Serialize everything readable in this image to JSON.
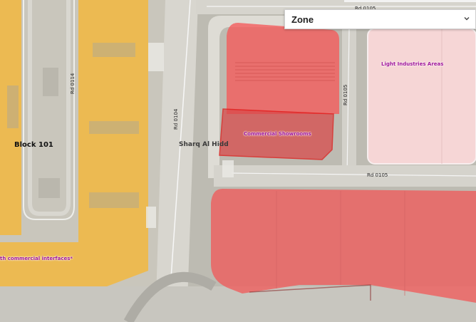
{
  "zone_selector": {
    "label": "Zone",
    "icon": "chevron-down-icon"
  },
  "roads": {
    "rd_0105_top": "Rd 0105",
    "rd_0105_mid": "Rd 0105",
    "rd_0105_vertical": "Rd 0105",
    "rd_0104": "Rd 0104",
    "rd_0114": "Rd 0114"
  },
  "places": {
    "block": "Block 101",
    "area": "Sharq Al Hidd"
  },
  "zones": {
    "light_industries": "Light Industries Areas",
    "commercial_showrooms": "Commercial Showrooms",
    "commercial_interfaces": "th commercial interfaces*"
  },
  "colors": {
    "commercial_fill": "#ef4444",
    "commercial_border": "#e01010",
    "residential_fill": "#f4b73a",
    "industrial_fill": "#f6d4d4",
    "zone_label": "#a0169a"
  }
}
